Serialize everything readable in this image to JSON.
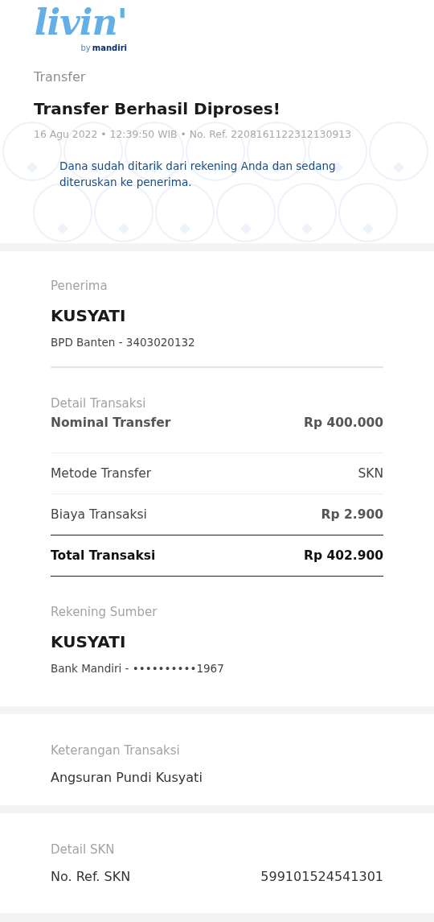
{
  "logo": {
    "wordmark": "livin'",
    "byline_prefix": "by",
    "byline_brand": "mandiri"
  },
  "header": {
    "category": "Transfer",
    "title": "Transfer Berhasil Diproses!",
    "meta": "16 Agu 2022 • 12:39:50 WIB • No. Ref. 2208161122312130913",
    "notice": "Dana sudah ditarik dari rekening Anda dan sedang diteruskan ke penerima."
  },
  "recipient": {
    "label": "Penerima",
    "name": "KUSYATI",
    "account": "BPD Banten - 3403020132"
  },
  "transaction": {
    "label": "Detail Transaksi",
    "rows": [
      {
        "kind": "bold",
        "label": "Nominal Transfer",
        "value": "Rp 400.000"
      },
      {
        "kind": "plain",
        "label": "Metode Transfer",
        "value": "SKN"
      },
      {
        "kind": "fee",
        "label": "Biaya Transaksi",
        "value": "Rp 2.900"
      },
      {
        "kind": "total",
        "label": "Total Transaksi",
        "value": "Rp 402.900"
      }
    ]
  },
  "source": {
    "label": "Rekening Sumber",
    "name": "KUSYATI",
    "account": "Bank Mandiri - ••••••••••1967"
  },
  "note": {
    "label": "Keterangan Transaksi",
    "text": "Angsuran Pundi Kusyati"
  },
  "skn": {
    "label": "Detail SKN",
    "rows": [
      {
        "label": "No. Ref. SKN",
        "value": "599101524541301"
      }
    ]
  }
}
